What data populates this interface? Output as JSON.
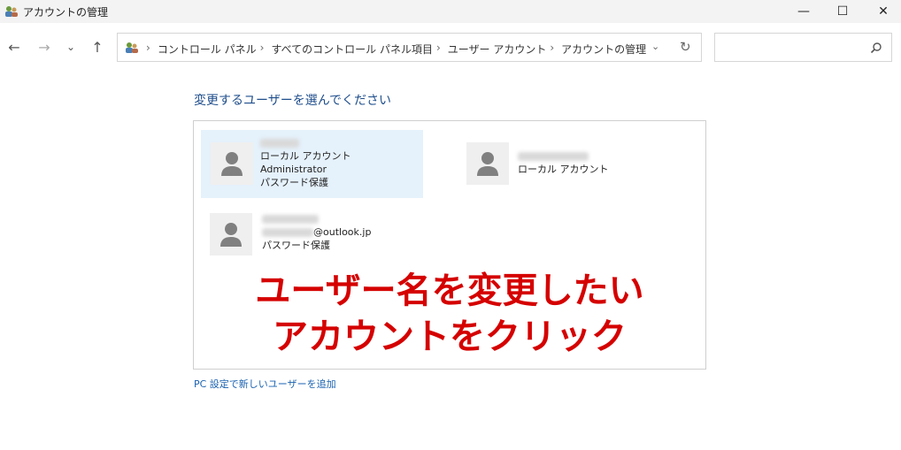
{
  "window": {
    "title": "アカウントの管理",
    "controls": {
      "minimize": "—",
      "maximize": "☐",
      "close": "✕"
    }
  },
  "nav": {
    "back": "←",
    "forward": "→",
    "recent": "⌄",
    "up": "↑"
  },
  "address": {
    "crumbs": [
      "コントロール パネル",
      "すべてのコントロール パネル項目",
      "ユーザー アカウント",
      "アカウントの管理"
    ],
    "separator": "›",
    "dropdown": "⌄",
    "refresh": "↻"
  },
  "search": {
    "placeholder": "",
    "icon": "search-icon"
  },
  "main": {
    "heading": "変更するユーザーを選んでください",
    "accounts": [
      {
        "lines": [
          "ローカル アカウント",
          "Administrator",
          "パスワード保護"
        ],
        "selected": true
      },
      {
        "lines": [
          "ローカル アカウント"
        ],
        "selected": false
      },
      {
        "email_suffix": "@outlook.jp",
        "lines": [
          "パスワード保護"
        ],
        "selected": false
      }
    ],
    "overlay": [
      "ユーザー名を変更したい",
      "アカウントをクリック"
    ],
    "add_link": "PC 設定で新しいユーザーを追加"
  },
  "colors": {
    "heading": "#1f4e8c",
    "overlay": "#d50000",
    "selected_tile": "#e5f1fb",
    "link": "#1a62b0"
  }
}
